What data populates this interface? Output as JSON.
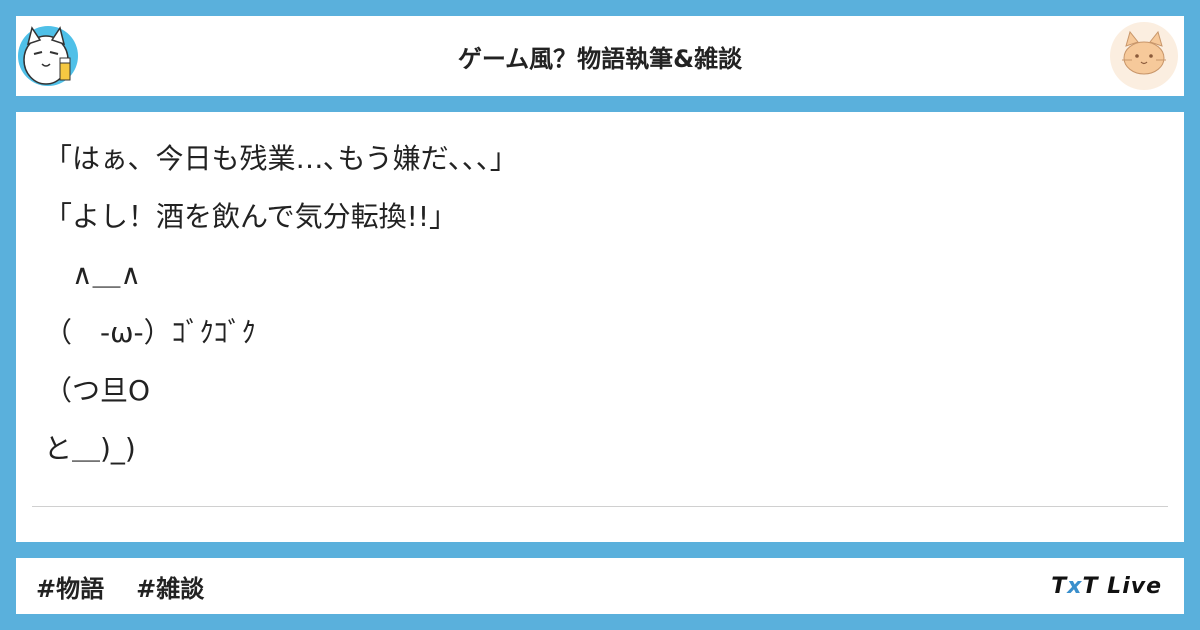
{
  "header": {
    "title": "ゲーム風？物語執筆&雑談",
    "left_avatar_icon": "cat-with-drink-avatar-icon",
    "right_avatar_icon": "cat-face-avatar-icon"
  },
  "post": {
    "lines": [
      "「はぁ、今日も残業…､もう嫌だ、、、」",
      "「よし！酒を飲んで気分転換!!」",
      "　∧＿∧",
      "（　-ω-）ｺﾞｸｺﾞｸ",
      "（つ旦O",
      "と＿)_)"
    ]
  },
  "footer": {
    "tags": [
      "#物語",
      "#雑談"
    ],
    "brand_t1": "T",
    "brand_x": "x",
    "brand_t2": "T",
    "brand_live": " Live"
  },
  "colors": {
    "background": "#5ab0dc",
    "brand_accent": "#3a8fcc"
  }
}
